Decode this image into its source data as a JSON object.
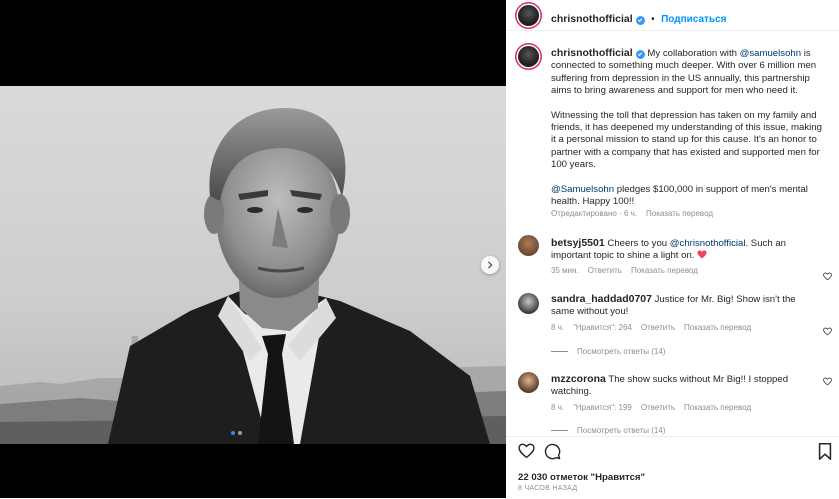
{
  "post": {
    "author": "chrisnothofficial",
    "follow_label": "Подписаться"
  },
  "caption": {
    "username": "chrisnothofficial",
    "p1_before": "My collaboration with ",
    "p1_mention": "@samuelsohn",
    "p1_after": " is connected to something much deeper. With over 6 million men suffering from depression in the US annually, this partnership aims to bring awareness and support for men who need it.",
    "p2": "Witnessing the toll that depression has taken on my family and friends, it has deepened my understanding of this issue, making it a personal mission to stand up for this cause. It's an honor to partner with a company that has existed and supported men for 100 years.",
    "p3_mention": "@Samuelsohn",
    "p3_after": " pledges $100,000 in support of men's mental health. Happy 100!!",
    "edited": "Отредактировано · 6 ч.",
    "translate": "Показать перевод"
  },
  "comments": [
    {
      "username": "betsyj5501",
      "text_before": " Cheers to you ",
      "mention": "@chrisnothofficial",
      "text_after": ". Such an important topic to shine a light on. ",
      "emoji": "❤️",
      "time": "35 мин.",
      "reply": "Ответить",
      "translate": "Показать перевод"
    },
    {
      "username": "sandra_haddad0707",
      "text": " Justice for Mr. Big! Show isn't the same without you!",
      "time": "8 ч.",
      "likes": "\"Нравится\": 264",
      "reply": "Ответить",
      "translate": "Показать перевод",
      "view_replies": "Посмотреть ответы (14)"
    },
    {
      "username": "mzzcorona",
      "text": " The show sucks without Mr Big!! I stopped watching.",
      "time": "8 ч.",
      "likes": "\"Нравится\": 199",
      "reply": "Ответить",
      "translate": "Показать перевод",
      "view_replies_partial": "Посмотреть ответы (14)"
    }
  ],
  "footer": {
    "likes_count": "22 030 отметок \"Нравится\"",
    "time_ago": "8 ЧАСОВ НАЗАД"
  },
  "carousel": {
    "current": 1,
    "total": 2
  },
  "icons": {
    "heart": "heart-outline-icon",
    "comment": "comment-bubble-icon",
    "save": "bookmark-icon",
    "next": "chevron-right-icon",
    "verified": "verified-badge-icon"
  },
  "colors": {
    "accent": "#0095f6",
    "mention": "#00376b",
    "muted": "#8e8e8e",
    "emoji_heart": "#ed4956",
    "story_ring": "#d62976"
  }
}
